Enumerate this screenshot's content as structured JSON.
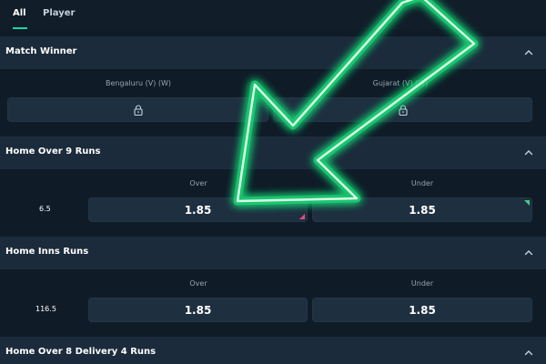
{
  "tabs": [
    {
      "label": "All",
      "active": true
    },
    {
      "label": "Player",
      "active": false
    }
  ],
  "markets": [
    {
      "title": "Match Winner",
      "columns": [
        "Bengaluru (V) (W)",
        "Gujarat (V) (W)"
      ],
      "locked": true
    },
    {
      "title": "Home Over 9 Runs",
      "columns": [
        "Over",
        "Under"
      ],
      "line": "6.5",
      "odds": [
        "1.85",
        "1.85"
      ]
    },
    {
      "title": "Home Inns Runs",
      "columns": [
        "Over",
        "Under"
      ],
      "line": "116.5",
      "odds": [
        "1.85",
        "1.85"
      ]
    },
    {
      "title": "Home Over 8 Delivery 4 Runs"
    }
  ],
  "colors": {
    "accent": "#1fd3a3",
    "odds_down": "#e0507a",
    "odds_up": "#3ed08a",
    "arrow_neon": "#2df08a"
  },
  "icons": {
    "collapse": "chevron-up-icon",
    "locked": "lock-icon",
    "overlay": "neon-arrow-icon"
  }
}
